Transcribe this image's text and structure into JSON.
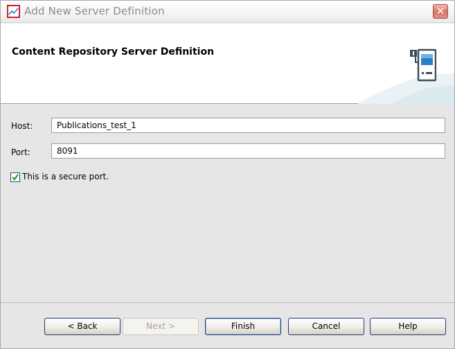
{
  "window": {
    "title": "Add New Server Definition",
    "close_glyph": "✕"
  },
  "header": {
    "title": "Content Repository Server Definition",
    "icon": "server-icon"
  },
  "form": {
    "host": {
      "label": "Host:",
      "value": "Publications_test_1"
    },
    "port": {
      "label": "Port:",
      "value": "8091"
    },
    "secure": {
      "label": "This is a secure port.",
      "checked": true
    }
  },
  "buttons": {
    "back": "< Back",
    "next": "Next >",
    "finish": "Finish",
    "cancel": "Cancel",
    "help": "Help"
  },
  "colors": {
    "accent": "#1f3d74",
    "icon_red": "#c8232c"
  }
}
